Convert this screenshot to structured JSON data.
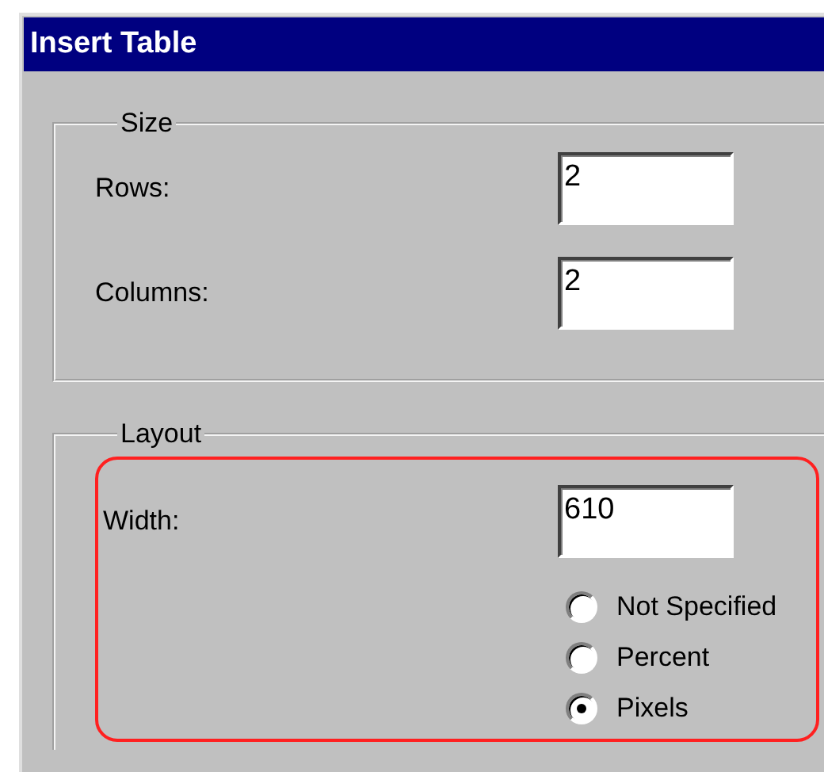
{
  "window": {
    "title": "Insert Table"
  },
  "size_group": {
    "title": "Size",
    "fields": [
      {
        "label": "Rows:",
        "value": "2"
      },
      {
        "label": "Columns:",
        "value": "2"
      }
    ]
  },
  "layout_group": {
    "title": "Layout",
    "width_field": {
      "label": "Width:",
      "value": "610"
    },
    "width_units": [
      {
        "label": "Not Specified",
        "selected": false
      },
      {
        "label": "Percent",
        "selected": false
      },
      {
        "label": "Pixels",
        "selected": true
      }
    ]
  }
}
